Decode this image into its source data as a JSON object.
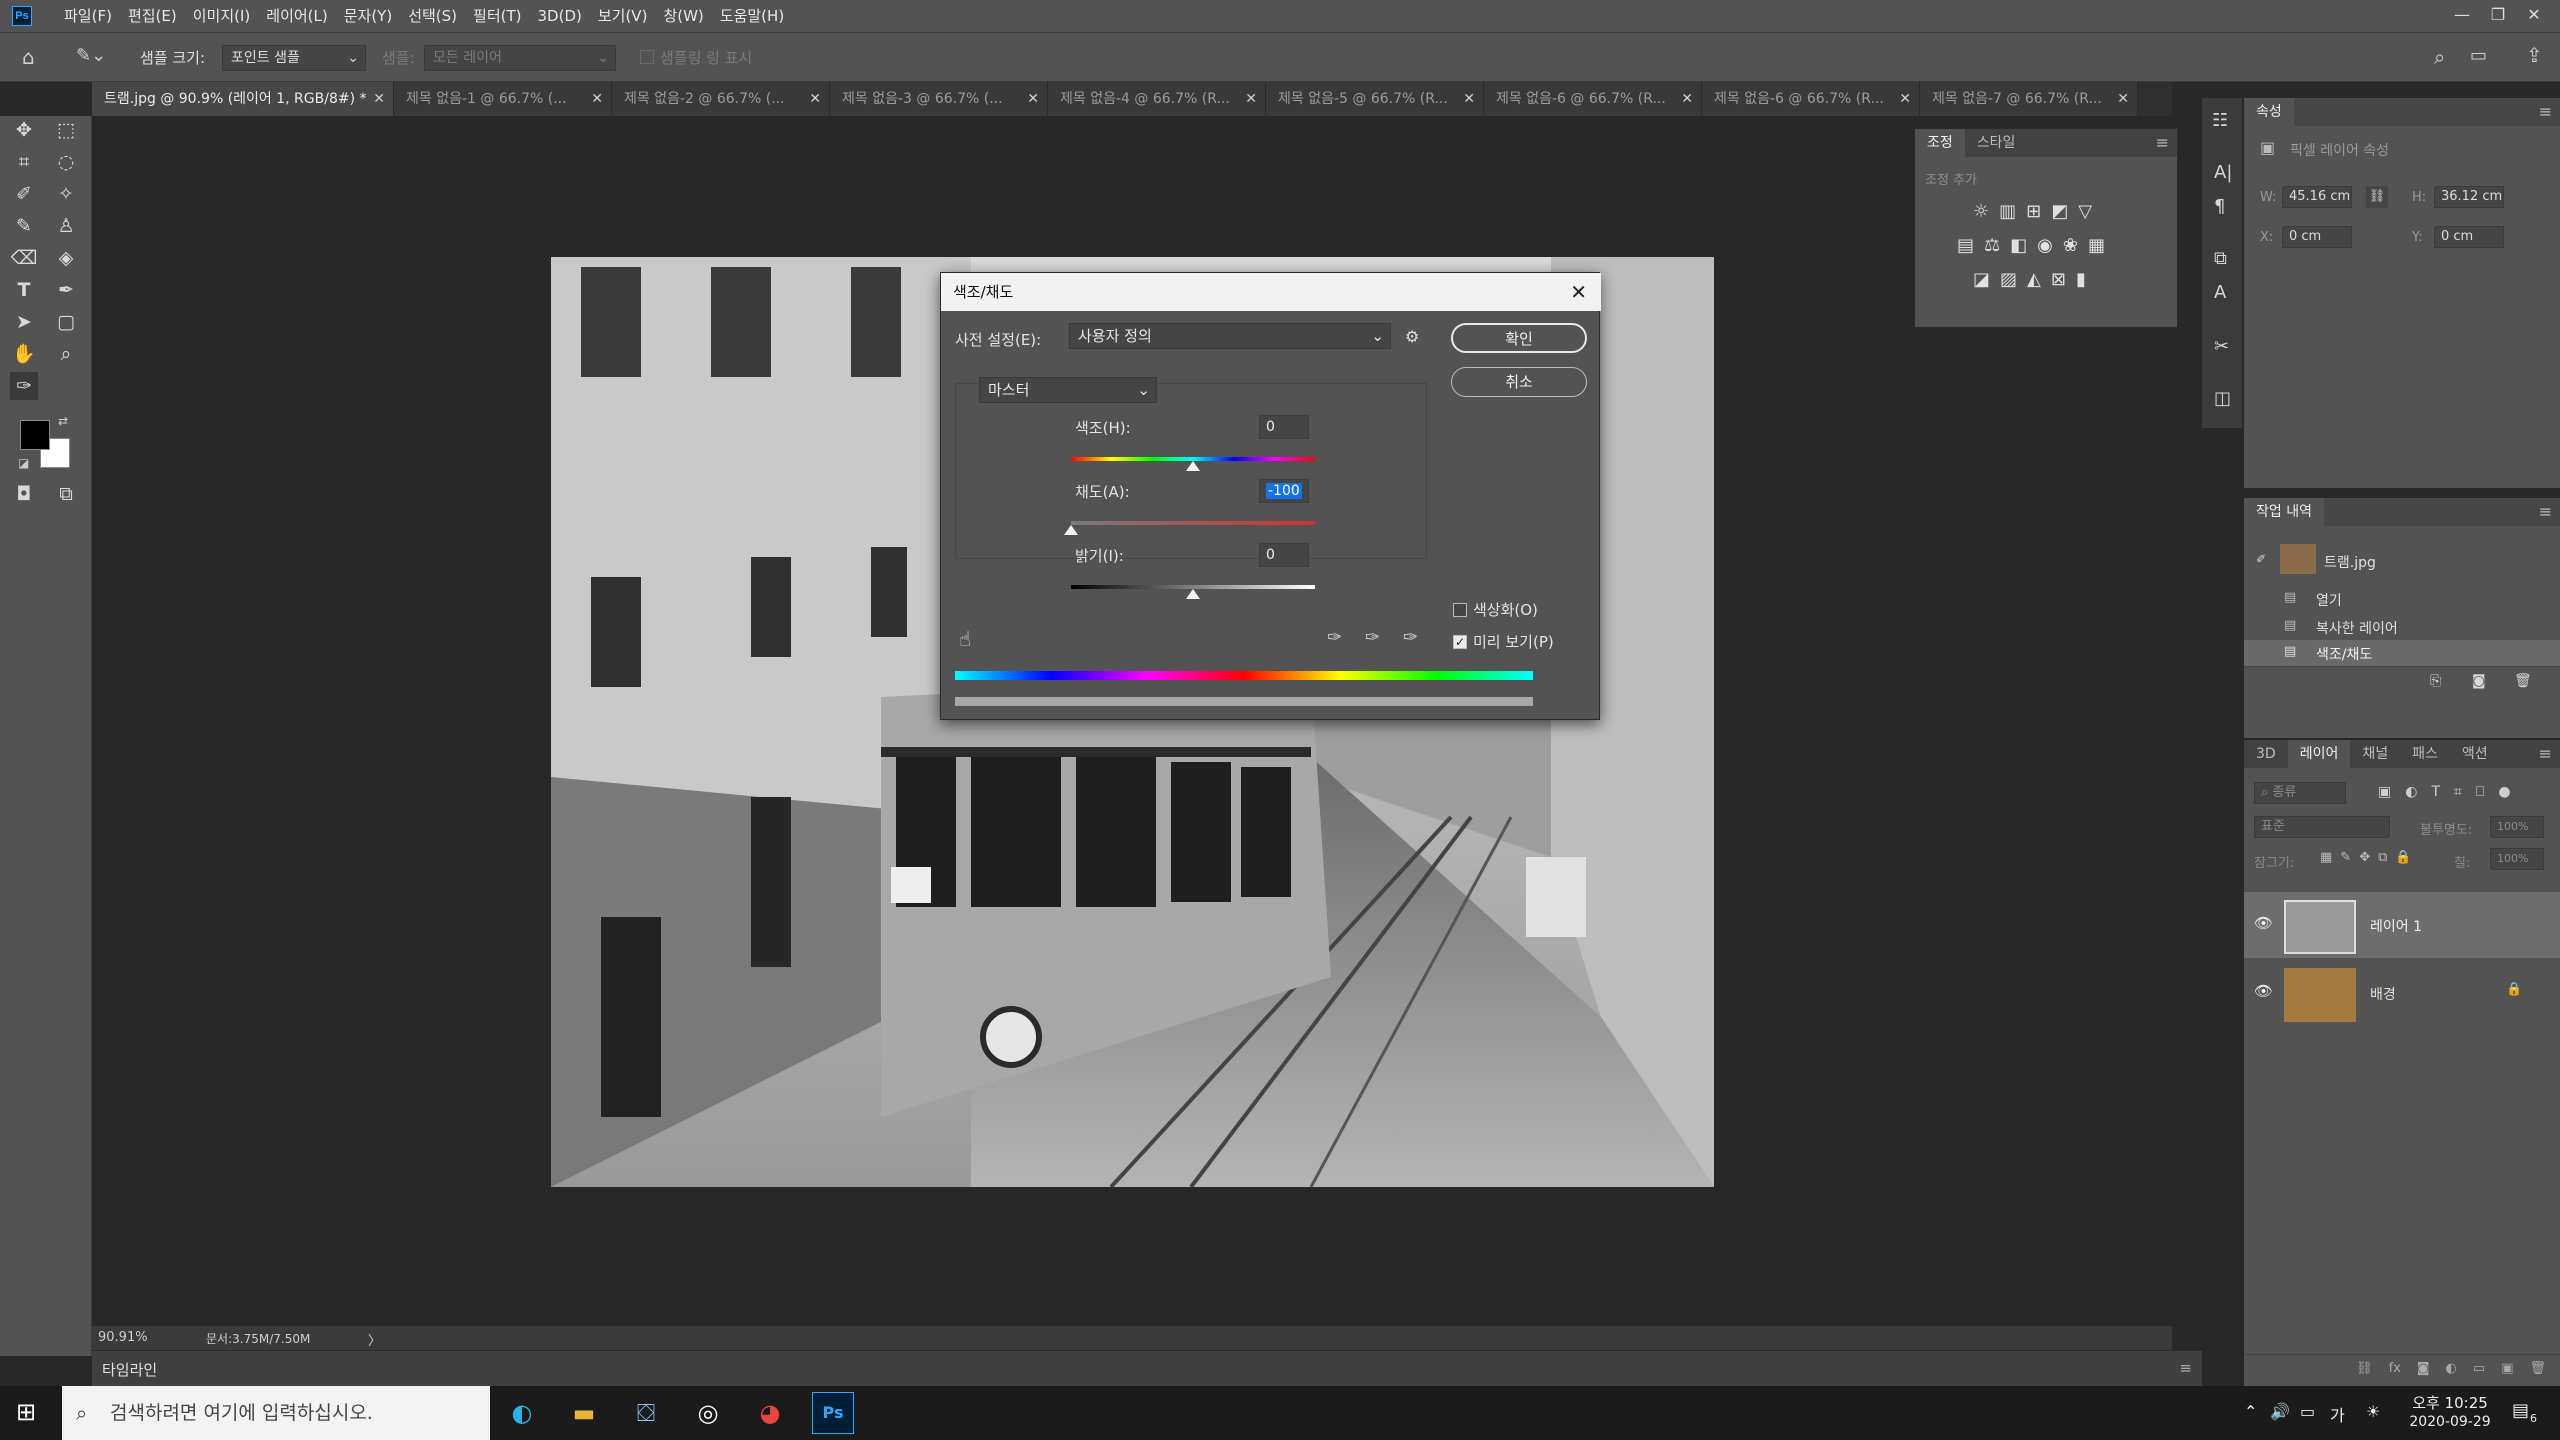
{
  "app": {
    "logo": "Ps",
    "menu": [
      "파일(F)",
      "편집(E)",
      "이미지(I)",
      "레이어(L)",
      "문자(Y)",
      "선택(S)",
      "필터(T)",
      "3D(D)",
      "보기(V)",
      "창(W)",
      "도움말(H)"
    ],
    "window_controls": [
      "—",
      "❐",
      "✕"
    ]
  },
  "options_bar": {
    "sample_size_label": "샘플 크기:",
    "sample_size_value": "포인트 샘플",
    "sample_label": "샘플:",
    "sample_value": "모든 레이어",
    "show_sampling_ring": "샘플링 링 표시"
  },
  "tabs": [
    {
      "label": "트램.jpg @ 90.9% (레이어 1, RGB/8#) *",
      "active": true
    },
    {
      "label": "제목 없음-1 @ 66.7% (...",
      "active": false
    },
    {
      "label": "제목 없음-2 @ 66.7% (...",
      "active": false
    },
    {
      "label": "제목 없음-3 @ 66.7% (...",
      "active": false
    },
    {
      "label": "제목 없음-4 @ 66.7% (R...",
      "active": false
    },
    {
      "label": "제목 없음-5 @ 66.7% (R...",
      "active": false
    },
    {
      "label": "제목 없음-6 @ 66.7% (R...",
      "active": false
    },
    {
      "label": "제목 없음-6 @ 66.7% (R...",
      "active": false
    },
    {
      "label": "제목 없음-7 @ 66.7% (R...",
      "active": false
    }
  ],
  "status": {
    "zoom": "90.91%",
    "doc_size": "문서:3.75M/7.50M",
    "arrow": "〉"
  },
  "timeline": {
    "label": "타임라인"
  },
  "adjustments_panel": {
    "tabs": [
      "조정",
      "스타일"
    ],
    "add_label": "조정 추가"
  },
  "properties_panel": {
    "tab": "속성",
    "subtitle": "픽셀 레이어 속성",
    "w_label": "W:",
    "w_value": "45.16 cm",
    "h_label": "H:",
    "h_value": "36.12 cm",
    "x_label": "X:",
    "x_value": "0 cm",
    "y_label": "Y:",
    "y_value": "0 cm"
  },
  "history_panel": {
    "tab": "작업 내역",
    "snapshot": "트램.jpg",
    "items": [
      "열기",
      "복사한 레이어",
      "색조/채도"
    ]
  },
  "layers_panel": {
    "tabs": [
      "3D",
      "레이어",
      "채널",
      "패스",
      "액션"
    ],
    "kind_placeholder": "종류",
    "blend_mode": "표준",
    "opacity_label": "불투명도:",
    "opacity_value": "100%",
    "lock_label": "잠그기:",
    "fill_label": "칠:",
    "fill_value": "100%",
    "layers": [
      {
        "name": "레이어 1",
        "selected": true,
        "locked": false
      },
      {
        "name": "배경",
        "selected": false,
        "locked": true
      }
    ],
    "footer_icons": [
      "⛓",
      "fx",
      "◙",
      "◐",
      "▭",
      "▣",
      "🗑"
    ]
  },
  "dialog": {
    "title": "색조/채도",
    "preset_label": "사전 설정(E):",
    "preset_value": "사용자 정의",
    "channel_value": "마스터",
    "hue_label": "색조(H):",
    "hue_value": "0",
    "saturation_label": "채도(A):",
    "saturation_value": "-100",
    "lightness_label": "밝기(I):",
    "lightness_value": "0",
    "ok_label": "확인",
    "cancel_label": "취소",
    "colorize_label": "색상화(O)",
    "colorize_checked": false,
    "preview_label": "미리 보기(P)",
    "preview_checked": true,
    "hue_level": 0.5,
    "saturation_level": 0.0,
    "lightness_level": 0.5
  },
  "taskbar": {
    "search_placeholder": "검색하려면 여기에 입력하십시오.",
    "time": "오후 10:25",
    "date": "2020-09-29",
    "ime": "가",
    "notifications": "6"
  },
  "colors": {
    "accent": "#31a8ff",
    "selection": "#1473e6"
  }
}
